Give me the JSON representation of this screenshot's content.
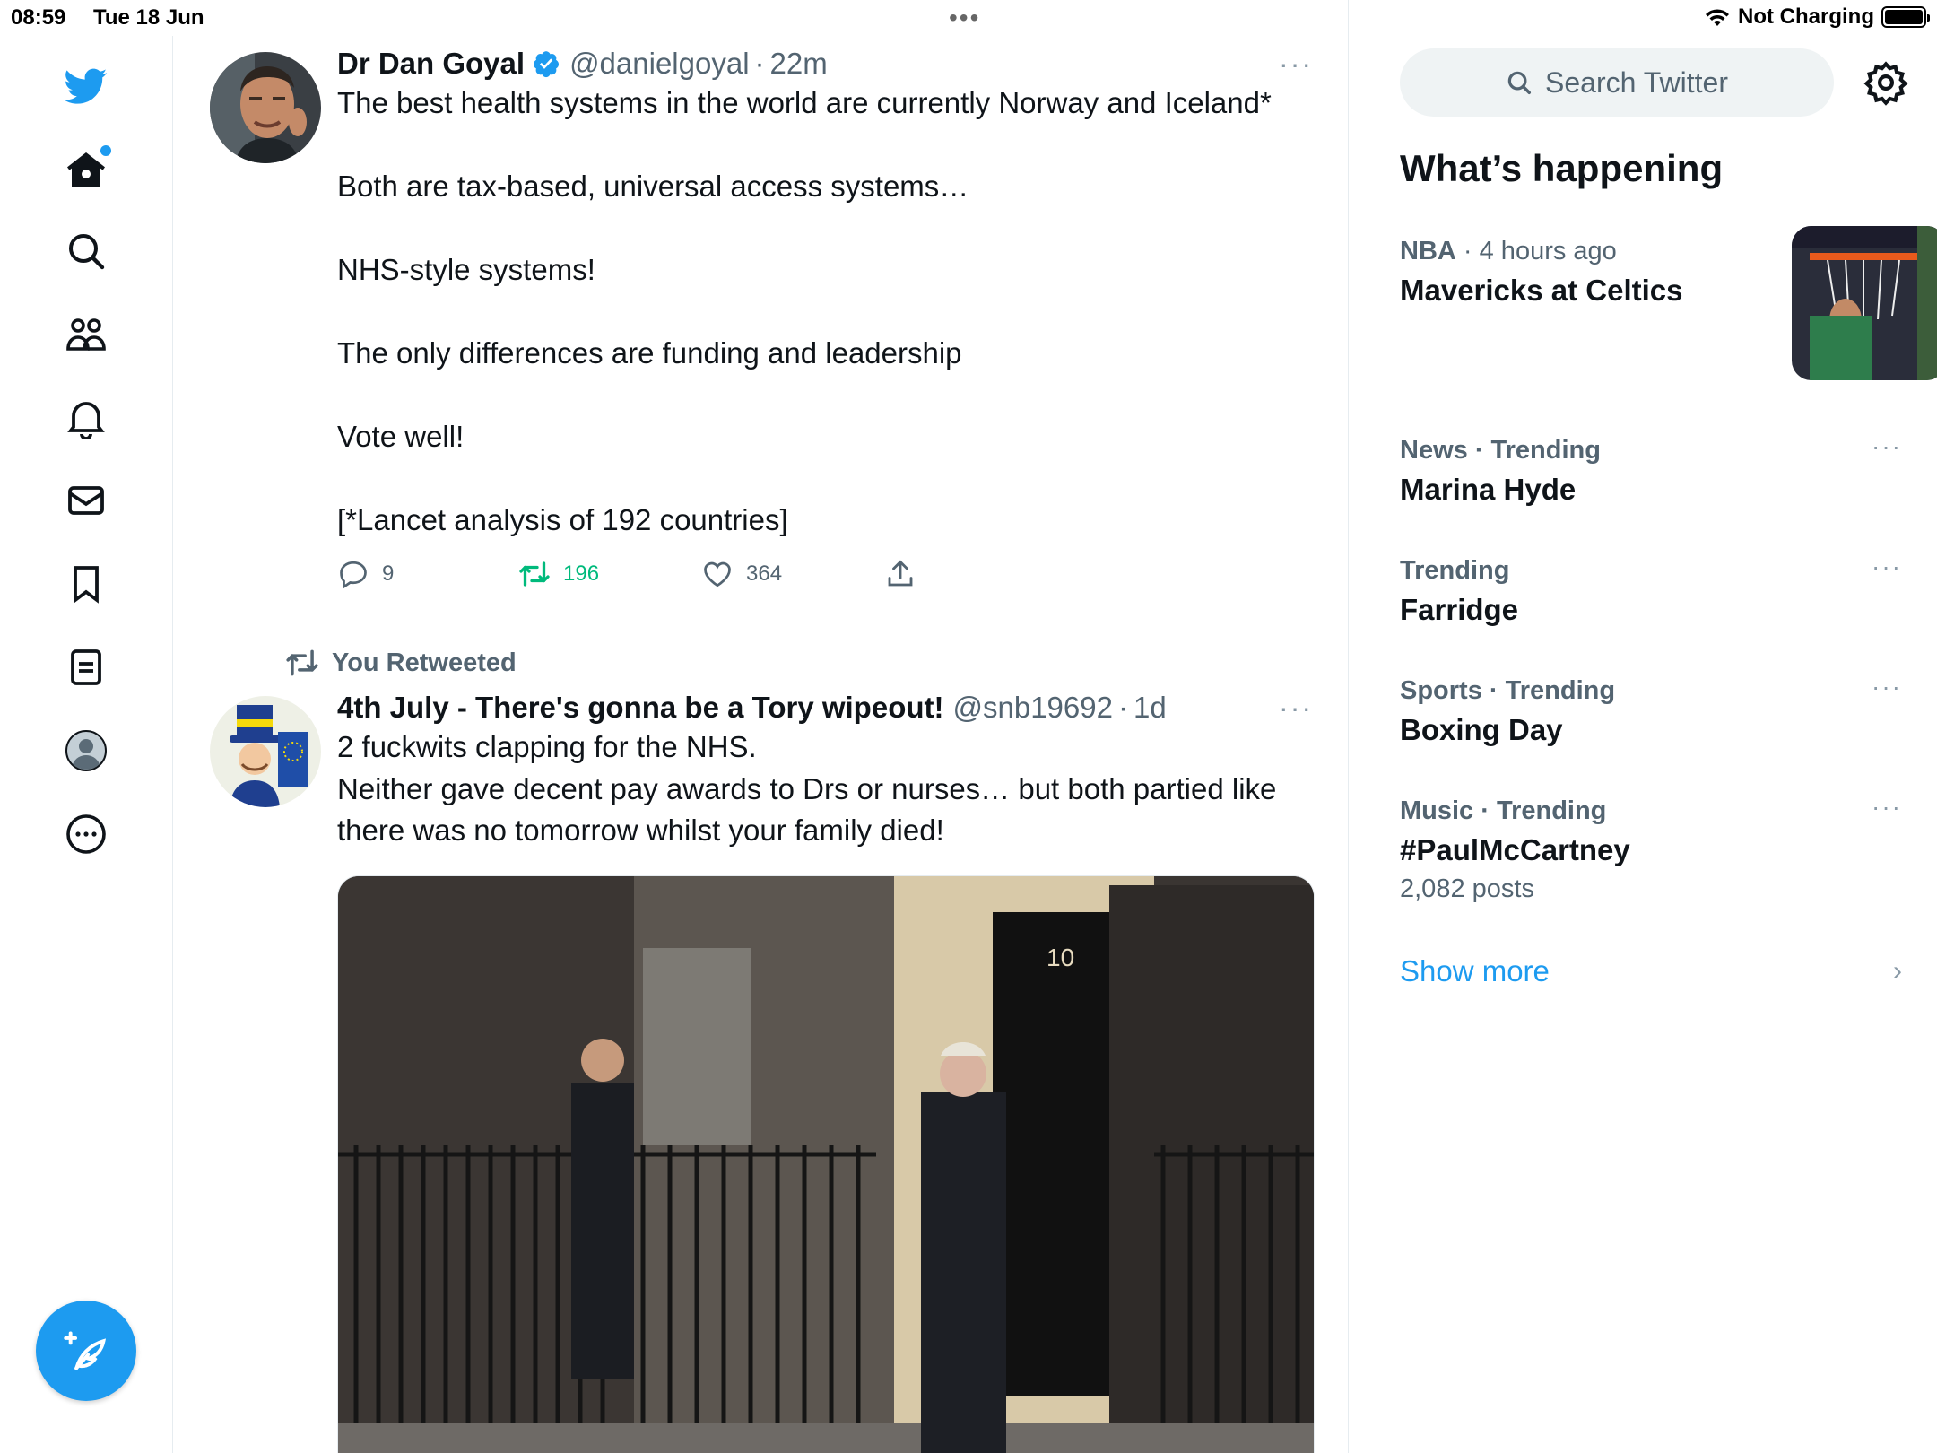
{
  "status_bar": {
    "time": "08:59",
    "date": "Tue 18 Jun",
    "battery_text": "Not Charging"
  },
  "nav": {
    "items": [
      "twitter-logo",
      "home",
      "explore",
      "communities",
      "notifications",
      "messages",
      "bookmarks",
      "lists",
      "profile",
      "more"
    ]
  },
  "tweets": [
    {
      "name": "Dr Dan Goyal",
      "verified": true,
      "handle": "@danielgoyal",
      "time": "22m",
      "more": "···",
      "text": "The best health systems in the world are currently Norway and Iceland*\n\nBoth are tax-based, universal access systems…\n\nNHS-style systems!\n\nThe only differences are funding and leadership\n\nVote well!\n\n[*Lancet analysis of 192 countries]",
      "replies": "9",
      "retweets": "196",
      "likes": "364"
    },
    {
      "retweet_label": "You Retweeted",
      "name": "4th July - There's gonna be a Tory wipeout!",
      "handle": "@snb19692",
      "time": "1d",
      "more": "···",
      "text": "2 fuckwits clapping for the NHS.\nNeither gave decent pay awards to Drs or nurses… but both partied like there was no tomorrow whilst your family died!",
      "media_door_number": "10"
    }
  ],
  "sidebar": {
    "search_placeholder": "Search Twitter",
    "heading": "What’s happening",
    "trends": [
      {
        "category": "NBA",
        "meta_suffix": "4 hours ago",
        "title": "Mavericks at Celtics",
        "has_image": true
      },
      {
        "category": "News · Trending",
        "title": "Marina Hyde",
        "more": "···"
      },
      {
        "category": "Trending",
        "title": "Farridge",
        "more": "···"
      },
      {
        "category": "Sports · Trending",
        "title": "Boxing Day",
        "more": "···"
      },
      {
        "category": "Music · Trending",
        "title": "#PaulMcCartney",
        "count": "2,082 posts",
        "more": "···"
      }
    ],
    "show_more": "Show more"
  },
  "colors": {
    "accent": "#1d9bf0",
    "retweet_green": "#00ba7c",
    "secondary_text": "#536471"
  }
}
